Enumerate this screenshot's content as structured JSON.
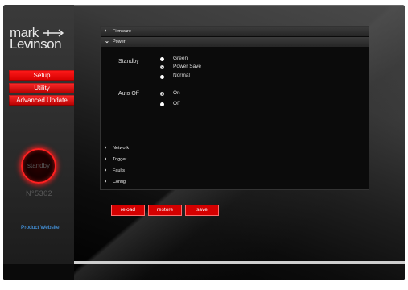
{
  "logo": {
    "line1": "mark",
    "line2": "Levinson"
  },
  "sidebar": {
    "nav": [
      {
        "label": "Setup"
      },
      {
        "label": "Utility"
      },
      {
        "label": "Advanced Update"
      }
    ],
    "standby_label": "standby",
    "model": "N°5302",
    "product_link": "Product Website"
  },
  "panel": {
    "sections": {
      "firmware": "Firmware",
      "power": "Power",
      "network": "Network",
      "trigger": "Trigger",
      "faults": "Faults",
      "config": "Config"
    },
    "standby": {
      "label": "Standby",
      "options": [
        "Green",
        "Power Save",
        "Normal"
      ],
      "selected": "Power Save"
    },
    "auto_off": {
      "label": "Auto Off",
      "options": [
        "On",
        "Off"
      ],
      "selected": "On"
    }
  },
  "buttons": {
    "reload": "reload",
    "restore": "restore",
    "save": "save"
  },
  "colors": {
    "accent_red": "#d40000",
    "link_blue": "#4aa8ff"
  }
}
